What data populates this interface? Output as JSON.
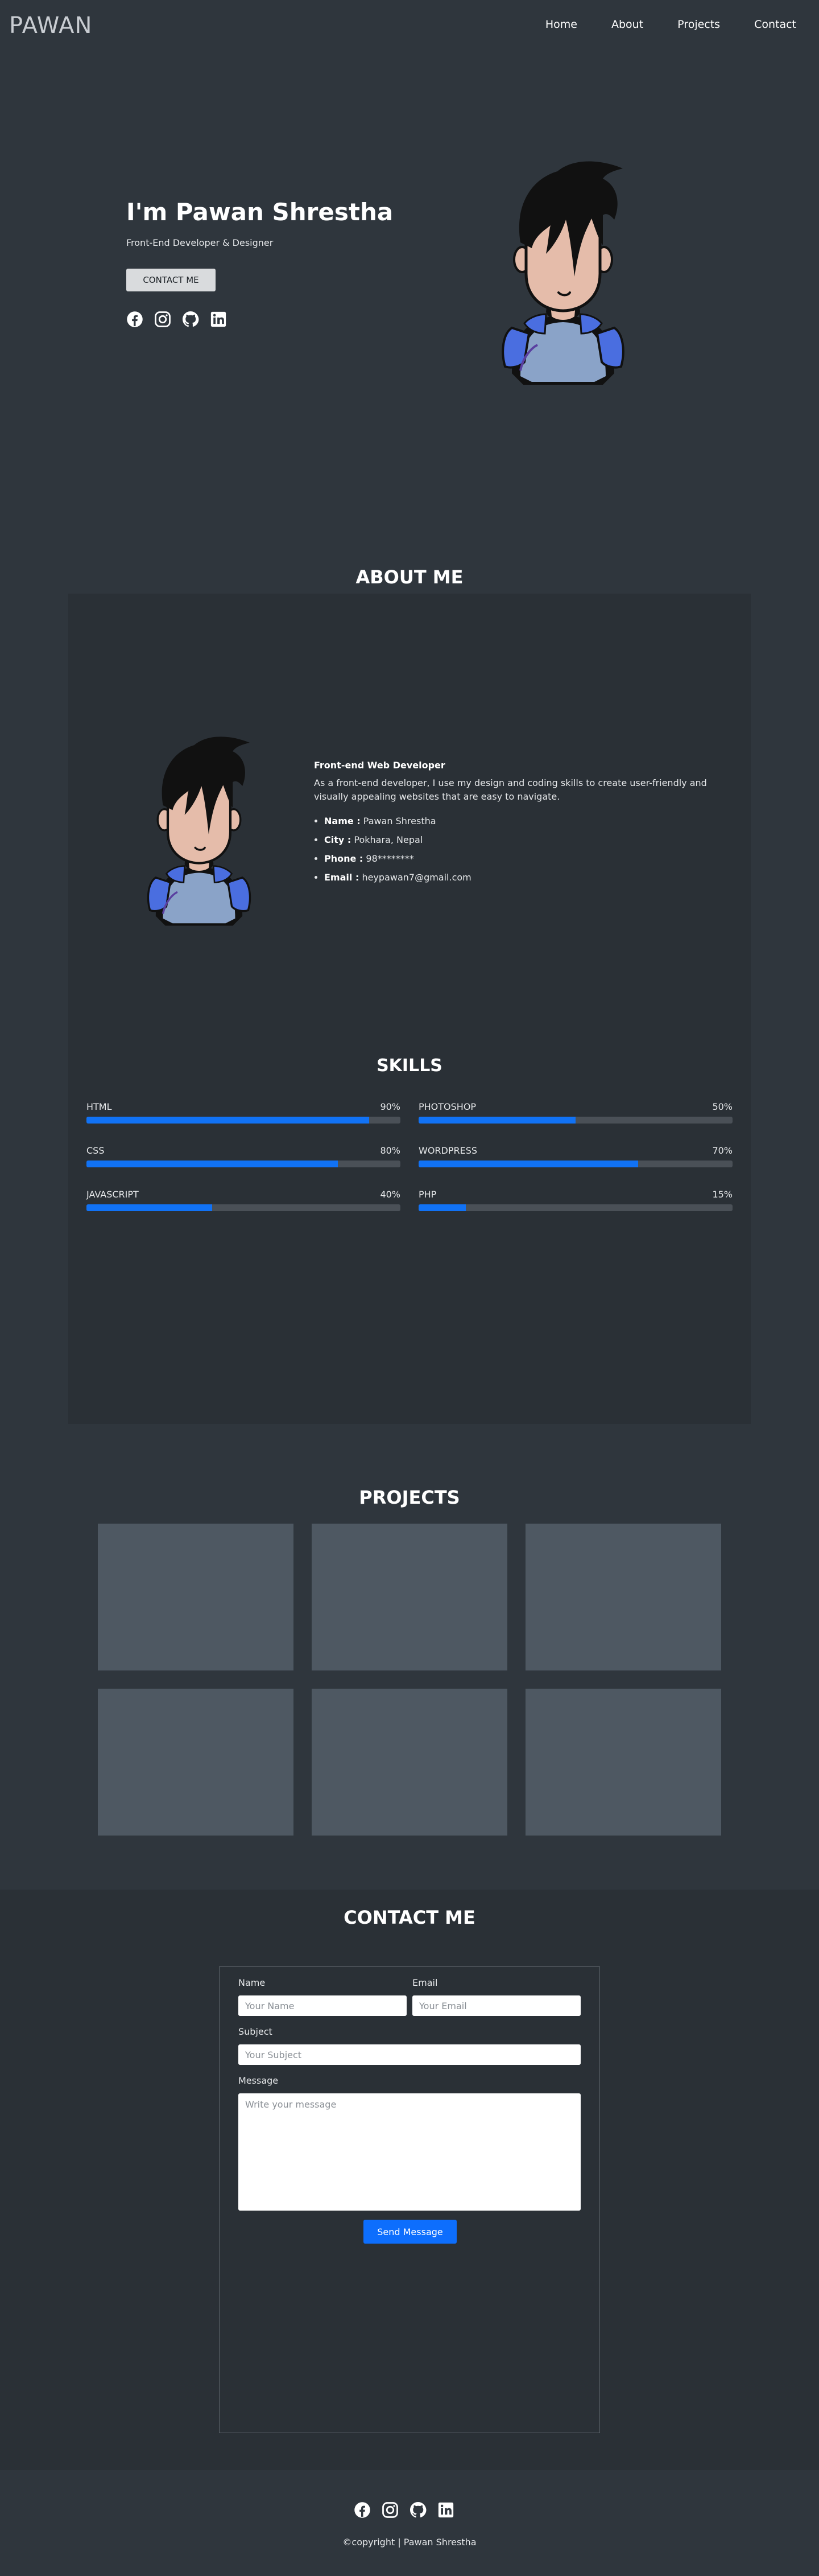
{
  "nav": {
    "logo": "PAWAN",
    "links": [
      "Home",
      "About",
      "Projects",
      "Contact"
    ]
  },
  "hero": {
    "title": "I'm Pawan Shrestha",
    "subtitle": "Front-End Developer & Designer",
    "button": "CONTACT ME",
    "social_icons": [
      "facebook-icon",
      "instagram-icon",
      "github-icon",
      "linkedin-icon"
    ]
  },
  "about": {
    "title": "ABOUT ME",
    "heading": "Front-end Web Developer",
    "description": "As a front-end developer, I use my design and coding skills to create user-friendly and visually appealing websites that are easy to navigate.",
    "details": [
      {
        "label": "Name :",
        "value": "Pawan Shrestha"
      },
      {
        "label": "City :",
        "value": "Pokhara, Nepal"
      },
      {
        "label": "Phone :",
        "value": "98********"
      },
      {
        "label": "Email :",
        "value": "heypawan7@gmail.com"
      }
    ]
  },
  "skills": {
    "title": "SKILLS",
    "items": [
      {
        "name": "HTML",
        "percent": "90%",
        "level": 90
      },
      {
        "name": "PHOTOSHOP",
        "percent": "50%",
        "level": 50
      },
      {
        "name": "CSS",
        "percent": "80%",
        "level": 80
      },
      {
        "name": "WORDPRESS",
        "percent": "70%",
        "level": 70
      },
      {
        "name": "JAVASCRIPT",
        "percent": "40%",
        "level": 40
      },
      {
        "name": "PHP",
        "percent": "15%",
        "level": 15
      }
    ]
  },
  "projects": {
    "title": "PROJECTS",
    "count": 6
  },
  "contact": {
    "title": "CONTACT ME",
    "name_label": "Name",
    "name_placeholder": "Your Name",
    "email_label": "Email",
    "email_placeholder": "Your Email",
    "subject_label": "Subject",
    "subject_placeholder": "Your Subject",
    "message_label": "Message",
    "message_placeholder": "Write your message",
    "send_button": "Send Message"
  },
  "footer": {
    "copyright": "©copyright | Pawan Shrestha"
  },
  "colors": {
    "background": "#2f363d",
    "panel": "#2a3036",
    "accent": "#1172f5",
    "project_card": "#4e5862"
  }
}
